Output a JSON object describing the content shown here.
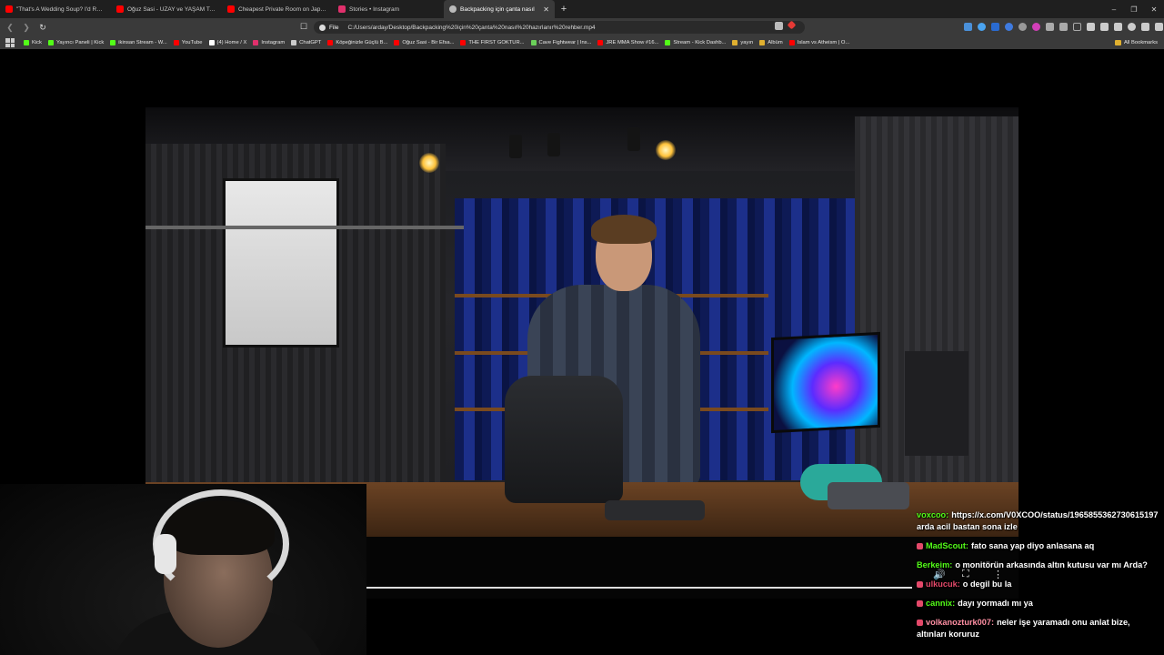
{
  "tabs": [
    {
      "title": "\"That's A Wedding Soup? I'd Rather",
      "icon": "youtube-icon",
      "color": "#ff0000"
    },
    {
      "title": "Oğuz Sasi - UZAY ve YAŞAM Teoriler",
      "icon": "youtube-icon",
      "color": "#ff0000"
    },
    {
      "title": "Cheapest Private Room on Japan's O",
      "icon": "youtube-icon",
      "color": "#ff0000"
    },
    {
      "title": "Stories • Instagram",
      "icon": "instagram-icon",
      "color": "#e1306c"
    },
    {
      "title": "Backpacking için çanta nasıl",
      "icon": "media-icon",
      "color": "#bbbbbb",
      "active": true
    }
  ],
  "new_tab": "+",
  "window_controls": {
    "minimize": "–",
    "maximize": "❐",
    "close": "✕"
  },
  "omnibox": {
    "scheme": "File",
    "url": "C:/Users/arday/Desktop/Backpacking%20için%20çanta%20nasıl%20hazırlanır%20rehber.mp4"
  },
  "bookmarks": [
    {
      "label": "Kick",
      "color": "#53fc18"
    },
    {
      "label": "Yayıncı Paneli | Kick",
      "color": "#53fc18"
    },
    {
      "label": "ikinsan Stream - W...",
      "color": "#53fc18"
    },
    {
      "label": "YouTube",
      "color": "#ff0000"
    },
    {
      "label": "(4) Home / X",
      "color": "#ffffff"
    },
    {
      "label": "Instagram",
      "color": "#e1306c"
    },
    {
      "label": "ChatGPT",
      "color": "#cccccc"
    },
    {
      "label": "Köpeğinizle Güçlü B...",
      "color": "#ff0000"
    },
    {
      "label": "Oğuz Sasi - Bir Efsa...",
      "color": "#ff0000"
    },
    {
      "label": "THE FIRST GOKTUR...",
      "color": "#ff0000"
    },
    {
      "label": "Cave Fightwear | Ins...",
      "color": "#6bd05a"
    },
    {
      "label": "JRE MMA Show #16...",
      "color": "#ff0000"
    },
    {
      "label": "Stream - Kick Dashb...",
      "color": "#53fc18"
    },
    {
      "label": "yayın",
      "color": "#e0b030"
    },
    {
      "label": "Albüm",
      "color": "#e0b030"
    },
    {
      "label": "Islam vs Atheism | O...",
      "color": "#ff0000"
    }
  ],
  "all_bookmarks": "All Bookmarks",
  "chat": [
    {
      "user": "voxcoo:",
      "user_color": "#53fc18",
      "text": "https://x.com/V0XCOO/status/1965855362730615197 arda acil bastan sona izle",
      "badge": false
    },
    {
      "user": "MadScout:",
      "user_color": "#53fc18",
      "text": "fato sana yap diyo anlasana aq",
      "badge": true
    },
    {
      "user": "Berkeim:",
      "user_color": "#53fc18",
      "text": "o monitörün arkasında altın kutusu var mı Arda?",
      "badge": false
    },
    {
      "user": "ulkucuk:",
      "user_color": "#e4496a",
      "text": "o degil bu la",
      "badge": true
    },
    {
      "user": "cannix:",
      "user_color": "#53fc18",
      "text": "dayı yormadı mı ya",
      "badge": true
    },
    {
      "user": "volkanozturk007:",
      "user_color": "#ff8fa3",
      "text": "neler işe yaramadı onu anlat bize, altınları koruruz",
      "badge": true
    }
  ]
}
